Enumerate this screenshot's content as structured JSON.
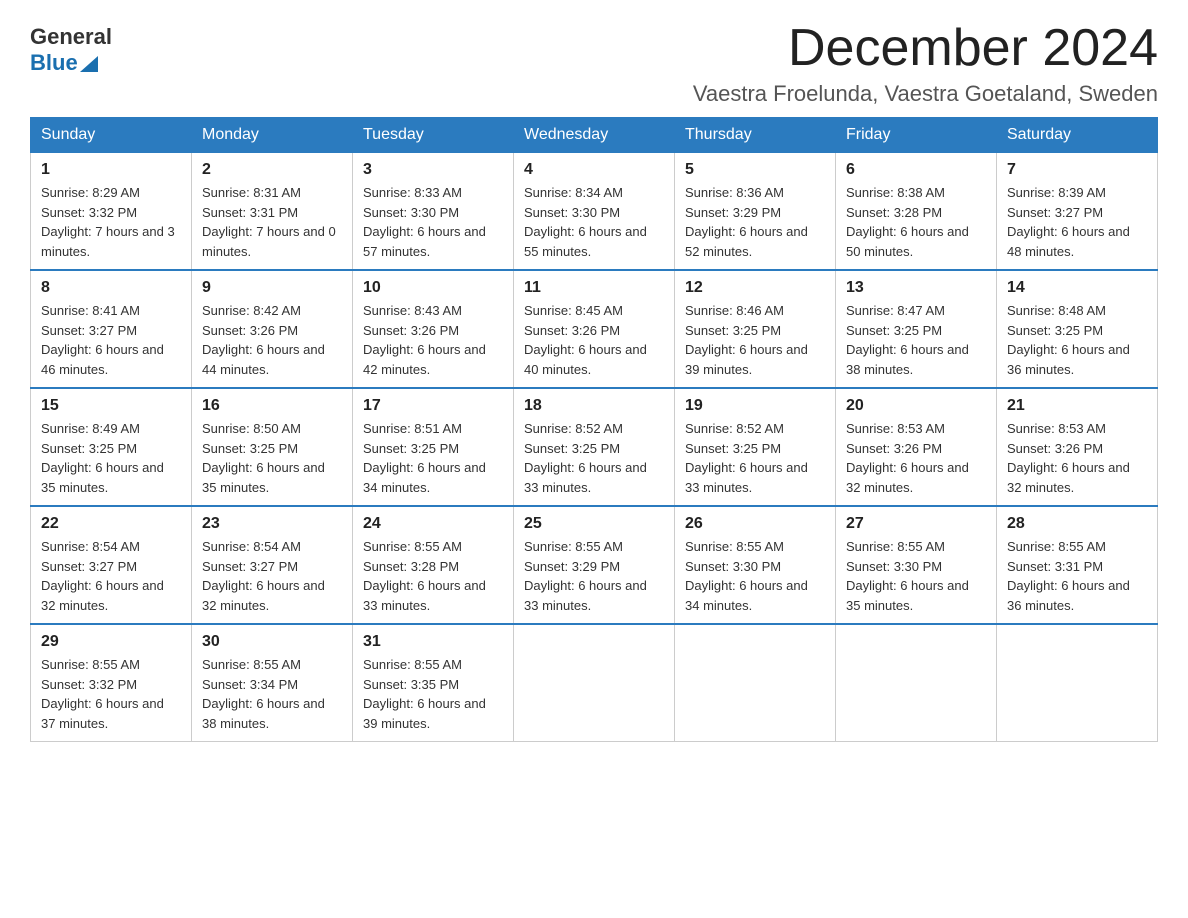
{
  "header": {
    "logo_general": "General",
    "logo_blue": "Blue",
    "month_title": "December 2024",
    "location": "Vaestra Froelunda, Vaestra Goetaland, Sweden"
  },
  "weekdays": [
    "Sunday",
    "Monday",
    "Tuesday",
    "Wednesday",
    "Thursday",
    "Friday",
    "Saturday"
  ],
  "weeks": [
    [
      {
        "day": "1",
        "sunrise": "8:29 AM",
        "sunset": "3:32 PM",
        "daylight": "7 hours and 3 minutes."
      },
      {
        "day": "2",
        "sunrise": "8:31 AM",
        "sunset": "3:31 PM",
        "daylight": "7 hours and 0 minutes."
      },
      {
        "day": "3",
        "sunrise": "8:33 AM",
        "sunset": "3:30 PM",
        "daylight": "6 hours and 57 minutes."
      },
      {
        "day": "4",
        "sunrise": "8:34 AM",
        "sunset": "3:30 PM",
        "daylight": "6 hours and 55 minutes."
      },
      {
        "day": "5",
        "sunrise": "8:36 AM",
        "sunset": "3:29 PM",
        "daylight": "6 hours and 52 minutes."
      },
      {
        "day": "6",
        "sunrise": "8:38 AM",
        "sunset": "3:28 PM",
        "daylight": "6 hours and 50 minutes."
      },
      {
        "day": "7",
        "sunrise": "8:39 AM",
        "sunset": "3:27 PM",
        "daylight": "6 hours and 48 minutes."
      }
    ],
    [
      {
        "day": "8",
        "sunrise": "8:41 AM",
        "sunset": "3:27 PM",
        "daylight": "6 hours and 46 minutes."
      },
      {
        "day": "9",
        "sunrise": "8:42 AM",
        "sunset": "3:26 PM",
        "daylight": "6 hours and 44 minutes."
      },
      {
        "day": "10",
        "sunrise": "8:43 AM",
        "sunset": "3:26 PM",
        "daylight": "6 hours and 42 minutes."
      },
      {
        "day": "11",
        "sunrise": "8:45 AM",
        "sunset": "3:26 PM",
        "daylight": "6 hours and 40 minutes."
      },
      {
        "day": "12",
        "sunrise": "8:46 AM",
        "sunset": "3:25 PM",
        "daylight": "6 hours and 39 minutes."
      },
      {
        "day": "13",
        "sunrise": "8:47 AM",
        "sunset": "3:25 PM",
        "daylight": "6 hours and 38 minutes."
      },
      {
        "day": "14",
        "sunrise": "8:48 AM",
        "sunset": "3:25 PM",
        "daylight": "6 hours and 36 minutes."
      }
    ],
    [
      {
        "day": "15",
        "sunrise": "8:49 AM",
        "sunset": "3:25 PM",
        "daylight": "6 hours and 35 minutes."
      },
      {
        "day": "16",
        "sunrise": "8:50 AM",
        "sunset": "3:25 PM",
        "daylight": "6 hours and 35 minutes."
      },
      {
        "day": "17",
        "sunrise": "8:51 AM",
        "sunset": "3:25 PM",
        "daylight": "6 hours and 34 minutes."
      },
      {
        "day": "18",
        "sunrise": "8:52 AM",
        "sunset": "3:25 PM",
        "daylight": "6 hours and 33 minutes."
      },
      {
        "day": "19",
        "sunrise": "8:52 AM",
        "sunset": "3:25 PM",
        "daylight": "6 hours and 33 minutes."
      },
      {
        "day": "20",
        "sunrise": "8:53 AM",
        "sunset": "3:26 PM",
        "daylight": "6 hours and 32 minutes."
      },
      {
        "day": "21",
        "sunrise": "8:53 AM",
        "sunset": "3:26 PM",
        "daylight": "6 hours and 32 minutes."
      }
    ],
    [
      {
        "day": "22",
        "sunrise": "8:54 AM",
        "sunset": "3:27 PM",
        "daylight": "6 hours and 32 minutes."
      },
      {
        "day": "23",
        "sunrise": "8:54 AM",
        "sunset": "3:27 PM",
        "daylight": "6 hours and 32 minutes."
      },
      {
        "day": "24",
        "sunrise": "8:55 AM",
        "sunset": "3:28 PM",
        "daylight": "6 hours and 33 minutes."
      },
      {
        "day": "25",
        "sunrise": "8:55 AM",
        "sunset": "3:29 PM",
        "daylight": "6 hours and 33 minutes."
      },
      {
        "day": "26",
        "sunrise": "8:55 AM",
        "sunset": "3:30 PM",
        "daylight": "6 hours and 34 minutes."
      },
      {
        "day": "27",
        "sunrise": "8:55 AM",
        "sunset": "3:30 PM",
        "daylight": "6 hours and 35 minutes."
      },
      {
        "day": "28",
        "sunrise": "8:55 AM",
        "sunset": "3:31 PM",
        "daylight": "6 hours and 36 minutes."
      }
    ],
    [
      {
        "day": "29",
        "sunrise": "8:55 AM",
        "sunset": "3:32 PM",
        "daylight": "6 hours and 37 minutes."
      },
      {
        "day": "30",
        "sunrise": "8:55 AM",
        "sunset": "3:34 PM",
        "daylight": "6 hours and 38 minutes."
      },
      {
        "day": "31",
        "sunrise": "8:55 AM",
        "sunset": "3:35 PM",
        "daylight": "6 hours and 39 minutes."
      },
      null,
      null,
      null,
      null
    ]
  ]
}
